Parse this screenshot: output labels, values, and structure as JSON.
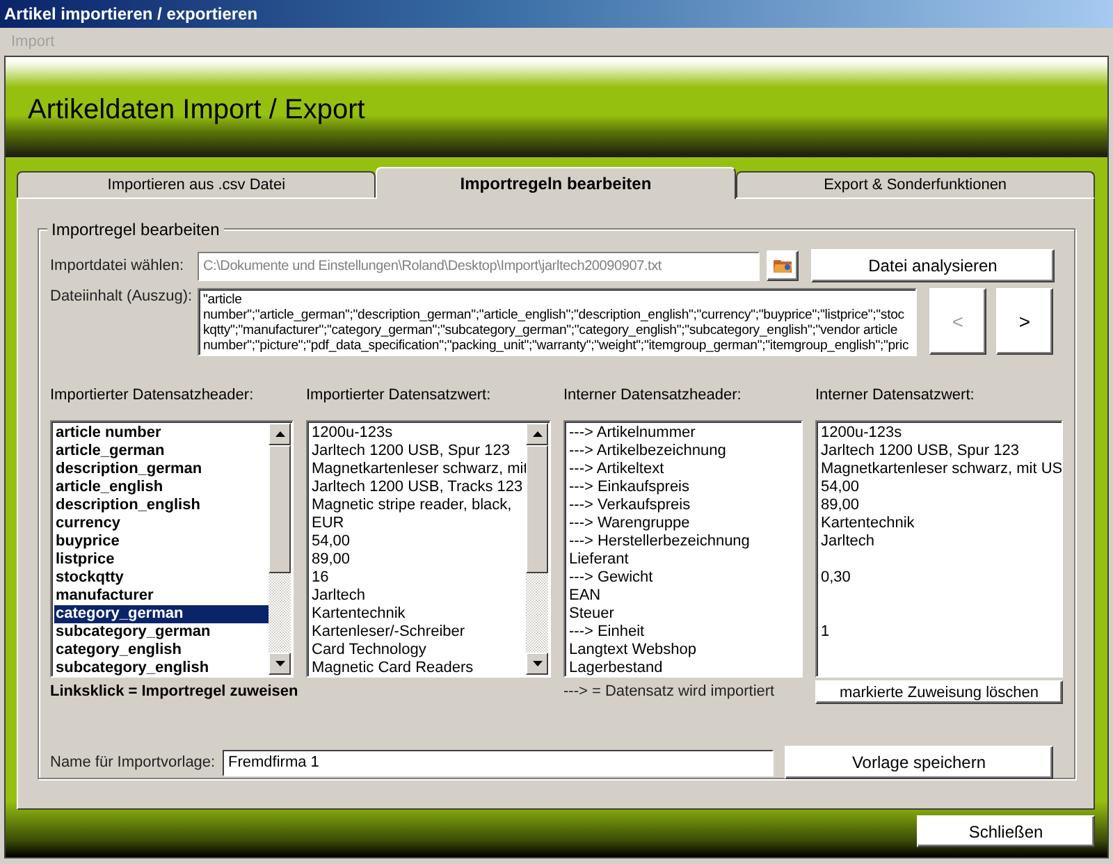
{
  "window": {
    "title": "Artikel importieren / exportieren"
  },
  "menu": [
    {
      "label": "Import",
      "disabled": true
    }
  ],
  "header": {
    "title": "Artikeldaten Import / Export"
  },
  "tabs": [
    {
      "label": "Importieren aus .csv Datei",
      "selected": false
    },
    {
      "label": "Importregeln bearbeiten",
      "selected": true
    },
    {
      "label": "Export & Sonderfunktionen",
      "selected": false
    }
  ],
  "group": {
    "title": "Importregel bearbeiten",
    "file": {
      "label": "Importdatei wählen:",
      "value": "C:\\Dokumente und Einstellungen\\Roland\\Desktop\\Import\\jarltech20090907.txt",
      "disabled": true
    },
    "analyze_button": "Datei analysieren",
    "content": {
      "label": "Dateiinhalt (Auszug):",
      "lines": [
        "\"article",
        "number\";\"article_german\";\"description_german\";\"article_english\";\"description_english\";\"currency\";\"buyprice\";\"listprice\";\"stoc",
        "kqtty\";\"manufacturer\";\"category_german\";\"subcategory_german\";\"category_english\";\"subcategory_english\";\"vendor article",
        "number\";\"picture\";\"pdf_data_specification\";\"packing_unit\";\"warranty\";\"weight\";\"itemgroup_german\";\"itemgroup_english\";\"pric"
      ]
    },
    "nav_buttons": [
      {
        "label": "<",
        "disabled": true
      },
      {
        "label": ">",
        "disabled": false
      }
    ],
    "lists": [
      {
        "label": "Importierter Datensatzheader:",
        "bold": true,
        "scrollbar": true,
        "items": [
          {
            "text": "article number",
            "selected": false
          },
          {
            "text": "article_german",
            "selected": false
          },
          {
            "text": "description_german",
            "selected": false
          },
          {
            "text": "article_english",
            "selected": false
          },
          {
            "text": "description_english",
            "selected": false
          },
          {
            "text": "currency",
            "selected": false
          },
          {
            "text": "buyprice",
            "selected": false
          },
          {
            "text": "listprice",
            "selected": false
          },
          {
            "text": "stockqtty",
            "selected": false
          },
          {
            "text": "manufacturer",
            "selected": false
          },
          {
            "text": "category_german",
            "selected": true
          },
          {
            "text": "subcategory_german",
            "selected": false
          },
          {
            "text": "category_english",
            "selected": false
          },
          {
            "text": "subcategory_english",
            "selected": false
          }
        ],
        "note": "Linksklick = Importregel zuweisen"
      },
      {
        "label": "Importierter Datensatzwert:",
        "bold": false,
        "scrollbar": true,
        "items": [
          {
            "text": "1200u-123s",
            "selected": false
          },
          {
            "text": "Jarltech 1200 USB, Spur 123",
            "selected": false
          },
          {
            "text": "Magnetkartenleser schwarz, mit",
            "selected": false
          },
          {
            "text": "Jarltech 1200 USB, Tracks 123",
            "selected": false
          },
          {
            "text": "Magnetic stripe reader, black,",
            "selected": false
          },
          {
            "text": "EUR",
            "selected": false
          },
          {
            "text": "54,00",
            "selected": false
          },
          {
            "text": "89,00",
            "selected": false
          },
          {
            "text": "16",
            "selected": false
          },
          {
            "text": "Jarltech",
            "selected": false
          },
          {
            "text": "Kartentechnik",
            "selected": false
          },
          {
            "text": "Kartenleser/-Schreiber",
            "selected": false
          },
          {
            "text": "Card Technology",
            "selected": false
          },
          {
            "text": "Magnetic Card Readers",
            "selected": false
          }
        ]
      },
      {
        "label": "Interner Datensatzheader:",
        "bold": false,
        "scrollbar": false,
        "items": [
          {
            "text": "---> Artikelnummer",
            "selected": false,
            "value": "1200u-123s"
          },
          {
            "text": "---> Artikelbezeichnung",
            "selected": false,
            "value": "Jarltech 1200 USB, Spur 123"
          },
          {
            "text": "---> Artikeltext",
            "selected": false,
            "value": "Magnetkartenleser schwarz, mit US"
          },
          {
            "text": "---> Einkaufspreis",
            "selected": false,
            "value": "54,00"
          },
          {
            "text": "---> Verkaufspreis",
            "selected": false,
            "value": "89,00"
          },
          {
            "text": "---> Warengruppe",
            "selected": false,
            "value": "Kartentechnik"
          },
          {
            "text": "---> Herstellerbezeichnung",
            "selected": false,
            "value": "Jarltech"
          },
          {
            "text": "Lieferant",
            "selected": false
          },
          {
            "text": "---> Gewicht",
            "selected": false,
            "value": "0,30"
          },
          {
            "text": "EAN",
            "selected": false
          },
          {
            "text": "Steuer",
            "selected": false
          },
          {
            "text": "---> Einheit",
            "selected": false,
            "value": "1"
          },
          {
            "text": "Langtext Webshop",
            "selected": false
          },
          {
            "text": "Lagerbestand",
            "selected": false
          }
        ],
        "note": "---> = Datensatz wird importiert"
      },
      {
        "label": "Interner Datensatzwert:",
        "bold": false,
        "scrollbar": false,
        "button": "markierte Zuweisung löschen"
      }
    ],
    "template": {
      "label": "Name für Importvorlage:",
      "value": "Fremdfirma 1"
    },
    "save_button": "Vorlage speichern"
  },
  "close_button": "Schließen"
}
